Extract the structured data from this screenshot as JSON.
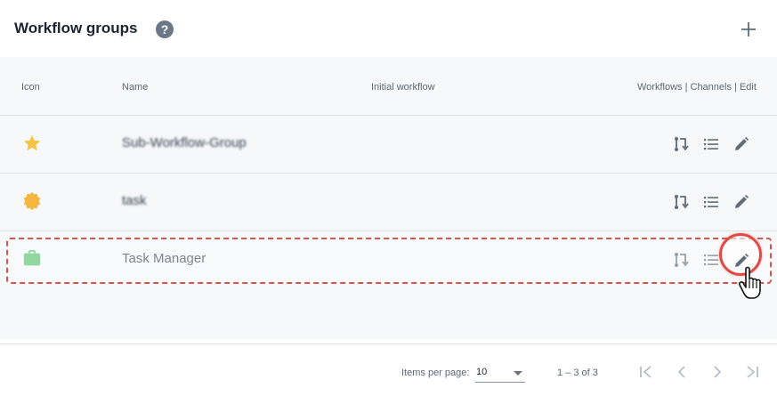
{
  "header": {
    "title": "Workflow groups",
    "help_icon": "help-circle-icon",
    "add_icon": "plus-icon"
  },
  "table": {
    "columns": {
      "icon": "Icon",
      "name": "Name",
      "initial_workflow": "Initial workflow",
      "actions": "Workflows | Channels | Edit"
    },
    "rows": [
      {
        "icon": "star-icon",
        "icon_color": "#f4c542",
        "name": "Sub-Workflow-Group",
        "initial_workflow": "",
        "blurred": true
      },
      {
        "icon": "badge-icon",
        "icon_color": "#f5b740",
        "name": "task",
        "initial_workflow": "",
        "blurred": true
      },
      {
        "icon": "briefcase-icon",
        "icon_color": "#59c26d",
        "name": "Task Manager",
        "initial_workflow": "",
        "blurred": false
      }
    ],
    "row_actions": [
      "workflows-icon",
      "channels-list-icon",
      "edit-pencil-icon"
    ]
  },
  "pagination": {
    "items_per_page_label": "Items per page:",
    "items_per_page_value": "10",
    "range_label": "1 – 3 of 3",
    "icons": [
      "first-page-icon",
      "prev-page-icon",
      "next-page-icon",
      "last-page-icon"
    ]
  },
  "colors": {
    "accent_highlight": "#e14b45",
    "icon_gray": "#5f6b78"
  }
}
